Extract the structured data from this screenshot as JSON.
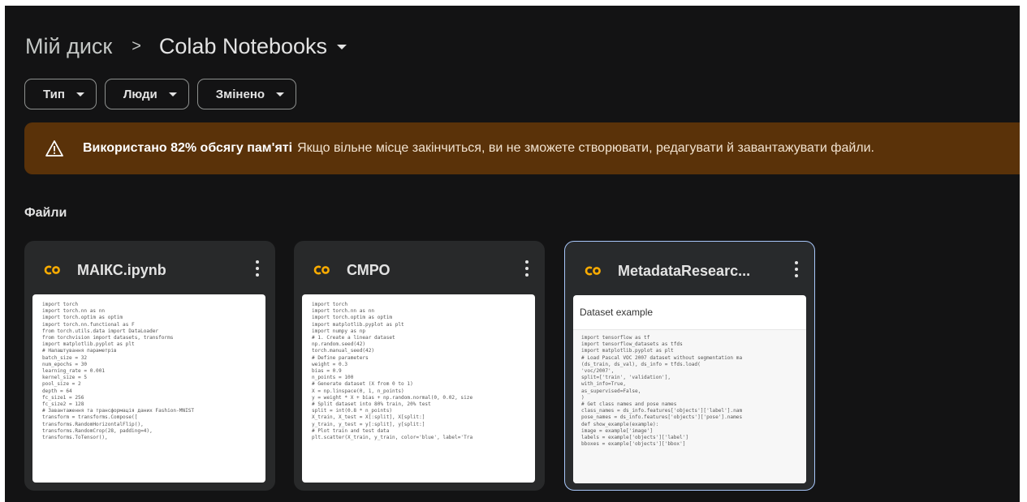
{
  "breadcrumb": {
    "root": "Мій диск",
    "separator": ">",
    "current": "Colab Notebooks"
  },
  "filters": [
    {
      "label": "Тип"
    },
    {
      "label": "Люди"
    },
    {
      "label": "Змінено"
    }
  ],
  "banner": {
    "icon": "warning-icon",
    "bold_text": "Використано 82% обсягу пам'яті",
    "text": "Якщо вільне місце закінчиться, ви не зможете створювати, редагувати й завантажувати файли.",
    "color": "#5a3209"
  },
  "section_title": "Файли",
  "colors": {
    "colab_orange": "#f9ab00",
    "colab_yellow": "#e8710a",
    "selected_border": "#a8c7fa"
  },
  "files": [
    {
      "name": "МАІКС.ipynb",
      "icon": "colab-icon",
      "preview_code": "import torch\nimport torch.nn as nn\nimport torch.optim as optim\nimport torch.nn.functional as F\nfrom torch.utils.data import DataLoader\nfrom torchvision import datasets, transforms\nimport matplotlib.pyplot as plt\n# Налаштування параметрів\nbatch_size = 32\nnum_epochs = 30\nlearning_rate = 0.001\nkernel_size = 5\npool_size = 2\ndepth = 64\nfc_size1 = 256\nfc_size2 = 128\n# Завантаження та трансформація даних Fashion-MNIST\ntransform = transforms.Compose([\ntransforms.RandomHorizontalFlip(),\ntransforms.RandomCrop(28, padding=4),\ntransforms.ToTensor(),"
    },
    {
      "name": "СМРО",
      "icon": "colab-icon",
      "preview_code": "import torch\nimport torch.nn as nn\nimport torch.optim as optim\nimport matplotlib.pyplot as plt\nimport numpy as np\n# 1. Create a linear dataset\nnp.random.seed(42)\ntorch.manual_seed(42)\n# Define parameters\nweight = 0.3\nbias = 0.9\nn_points = 100\n# Generate dataset (X from 0 to 1)\nX = np.linspace(0, 1, n_points)\ny = weight * X + bias + np.random.normal(0, 0.02, size\n# Split dataset into 80% train, 20% test\nsplit = int(0.8 * n_points)\nX_train, X_test = X[:split], X[split:]\ny_train, y_test = y[:split], y[split:]\n# Plot train and test data\nplt.scatter(X_train, y_train, color='blue', label='Tra"
    },
    {
      "name": "MetadataResearc...",
      "icon": "colab-icon",
      "selected": true,
      "preview_heading": "Dataset example",
      "preview_code": "import tensorflow as tf\nimport tensorflow_datasets as tfds\nimport matplotlib.pyplot as plt\n# Load Pascal VOC 2007 dataset without segmentation ma\n(ds_train, ds_val), ds_info = tfds.load(\n'voc/2007',\nsplit=['train', 'validation'],\nwith_info=True,\nas_supervised=False,\n)\n# Get class names and pose names\nclass_names = ds_info.features['objects']['label'].nam\npose_names = ds_info.features['objects']['pose'].names\ndef show_example(example):\nimage = example['image']\nlabels = example['objects']['label']\nbboxes = example['objects']['bbox']"
    }
  ]
}
